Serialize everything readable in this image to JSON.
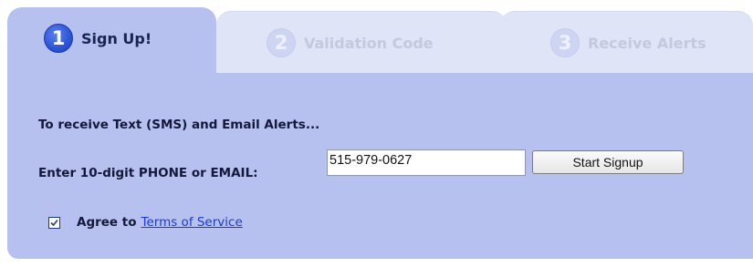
{
  "tabs": [
    {
      "number": "1",
      "label": "Sign Up!",
      "active": true
    },
    {
      "number": "2",
      "label": "Validation Code",
      "active": false
    },
    {
      "number": "3",
      "label": "Receive Alerts",
      "active": false
    }
  ],
  "form": {
    "intro": "To receive Text (SMS) and Email Alerts...",
    "phone_label": "Enter 10-digit PHONE or EMAIL:",
    "phone_value": "515-979-0627",
    "start_button": "Start Signup",
    "agree_label": "Agree to",
    "agree_checked": true,
    "terms_link": "Terms of Service"
  },
  "colors": {
    "panel": "#b6c1ef",
    "inactive_tab": "#dfe4f6",
    "step_active": "#2b54d8",
    "link": "#1b3bd6"
  },
  "icons": {
    "step": "numbered-circle-icon",
    "checkbox": "checkmark-icon"
  }
}
